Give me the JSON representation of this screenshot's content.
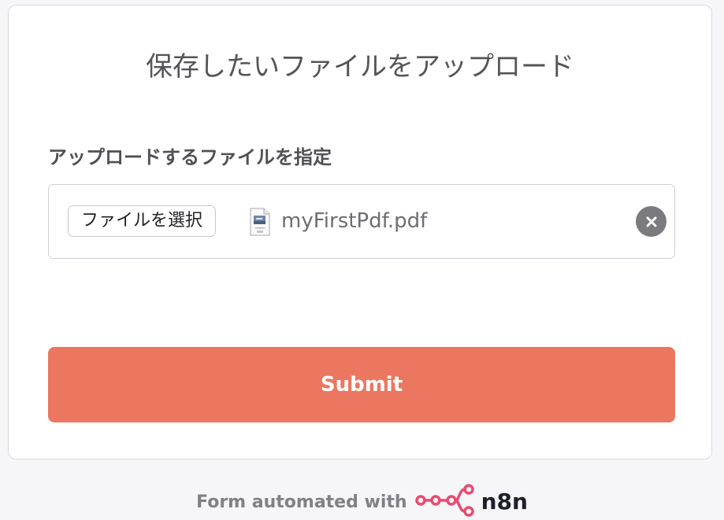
{
  "form": {
    "title": "保存したいファイルをアップロード",
    "field_label": "アップロードするファイルを指定",
    "file_input": {
      "choose_label": "ファイルを選択",
      "file_name": "myFirstPdf.pdf",
      "file_icon": "pdf-file-icon",
      "clear_icon": "close-icon"
    },
    "submit_label": "Submit"
  },
  "footer": {
    "text": "Form automated with",
    "brand": "n8n",
    "brand_icon": "n8n-logo-icon"
  },
  "colors": {
    "accent": "#ec7760",
    "brand_pink": "#ea4b71",
    "page_background": "#f6f6f9",
    "card_background": "#ffffff"
  }
}
